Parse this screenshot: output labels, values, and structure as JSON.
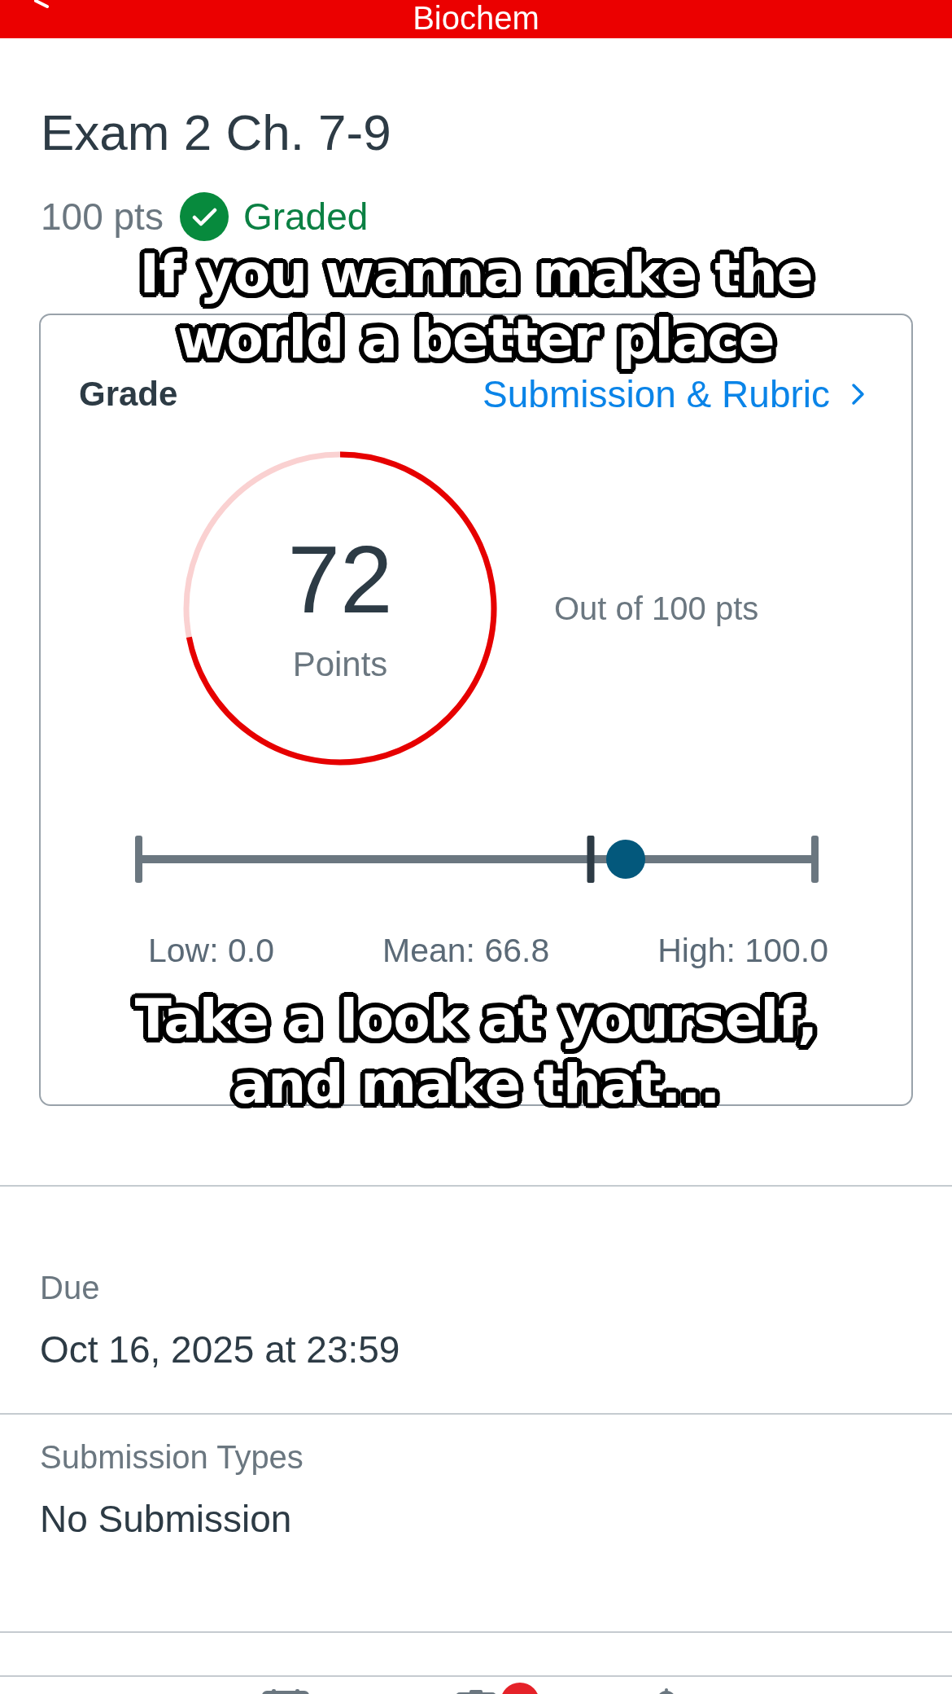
{
  "header": {
    "title": "Biochem"
  },
  "assignment": {
    "title": "Exam 2 Ch. 7-9",
    "points": "100 pts",
    "status": "Graded"
  },
  "grade_card": {
    "title": "Grade",
    "link": "Submission & Rubric",
    "score": {
      "value": "72",
      "unit": "Points",
      "level": 0.72
    },
    "out_of": "Out of 100 pts",
    "distribution": {
      "mean_marker": {
        "level": 0.668
      },
      "labels": [
        "Low: 0.0",
        "Mean: 66.8",
        "High: 100.0"
      ]
    }
  },
  "details": [
    {
      "label": "Due",
      "value": "Oct 16, 2025 at 23:59"
    },
    {
      "label": "Submission Types",
      "value": "No Submission"
    }
  ],
  "tab_bar": {
    "tabs": [
      {
        "kind": "calendar",
        "badge": false
      },
      {
        "kind": "todo",
        "badge": true
      },
      {
        "kind": "bell",
        "badge": false
      }
    ]
  },
  "captions": [
    "If you wanna make the world a better place",
    "Take a look at yourself, and make that..."
  ]
}
